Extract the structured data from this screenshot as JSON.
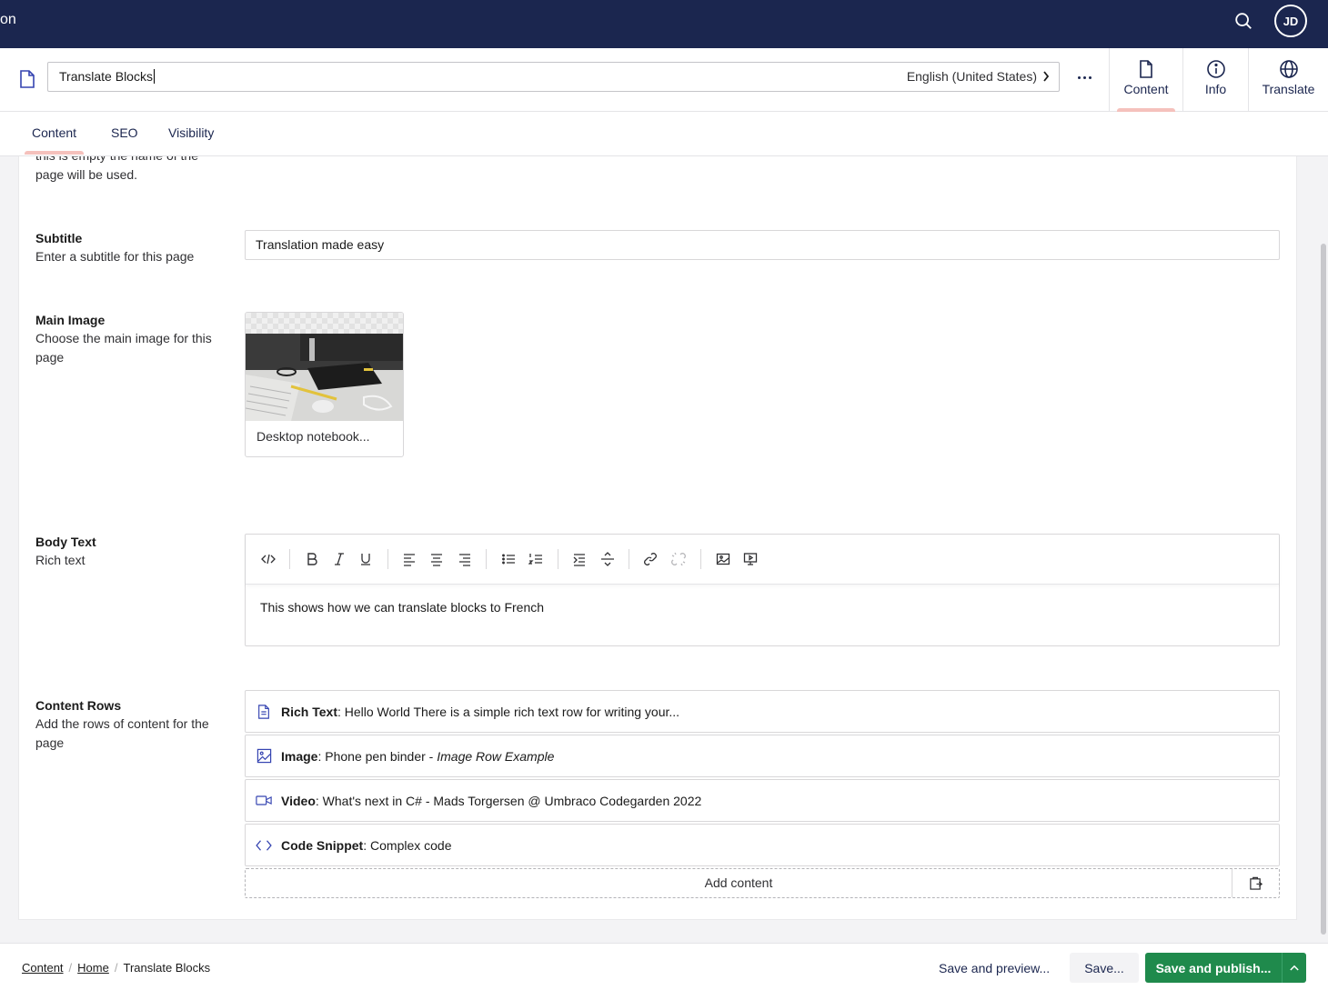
{
  "topbar": {
    "brand_fragment": "on",
    "avatar_initials": "JD",
    "search_icon": "search-icon"
  },
  "header": {
    "node_name": "Translate Blocks",
    "culture": "English (United States)",
    "apps": [
      {
        "label": "Content",
        "icon": "document-icon",
        "active": true
      },
      {
        "label": "Info",
        "icon": "info-icon",
        "active": false
      },
      {
        "label": "Translate",
        "icon": "globe-icon",
        "active": false
      }
    ]
  },
  "tabs": [
    {
      "label": "Content",
      "active": true
    },
    {
      "label": "SEO",
      "active": false
    },
    {
      "label": "Visibility",
      "active": false
    }
  ],
  "properties": {
    "title_desc_cut": "this is empty the name of the page will be used.",
    "subtitle": {
      "label": "Subtitle",
      "description": "Enter a subtitle for this page",
      "value": "Translation made easy"
    },
    "main_image": {
      "label": "Main Image",
      "description": "Choose the main image for this page",
      "media_name": "Desktop notebook..."
    },
    "body_text": {
      "label": "Body Text",
      "description": "Rich text",
      "content": "This shows how we can translate blocks to French",
      "toolbar": [
        "code-icon",
        "bold-icon",
        "italic-icon",
        "underline-icon",
        "align-left-icon",
        "align-center-icon",
        "align-right-icon",
        "bullet-list-icon",
        "numbered-list-icon",
        "indent-icon",
        "strikethrough-icon",
        "link-icon",
        "unlink-icon",
        "image-icon",
        "embed-icon"
      ]
    },
    "content_rows": {
      "label": "Content Rows",
      "description": "Add the rows of content for the page",
      "blocks": [
        {
          "type": "Rich Text",
          "text": "Hello World There is a simple rich text row for writing your...",
          "extra": "",
          "icon": "document-icon"
        },
        {
          "type": "Image",
          "text": "Phone pen binder - ",
          "extra": "Image Row Example",
          "icon": "picture-icon"
        },
        {
          "type": "Video",
          "text": "What's next in C# - Mads Torgersen @ Umbraco Codegarden 2022",
          "extra": "",
          "icon": "video-icon"
        },
        {
          "type": "Code Snippet",
          "text": "Complex code",
          "extra": "",
          "icon": "code-icon"
        }
      ],
      "add_label": "Add content"
    }
  },
  "footer": {
    "breadcrumbs": [
      "Content",
      "Home",
      "Translate Blocks"
    ],
    "save_preview": "Save and preview...",
    "save": "Save...",
    "save_publish": "Save and publish..."
  },
  "colors": {
    "topbar": "#1b264f",
    "accent": "#f5c1bc",
    "publish": "#1f8a4c"
  }
}
